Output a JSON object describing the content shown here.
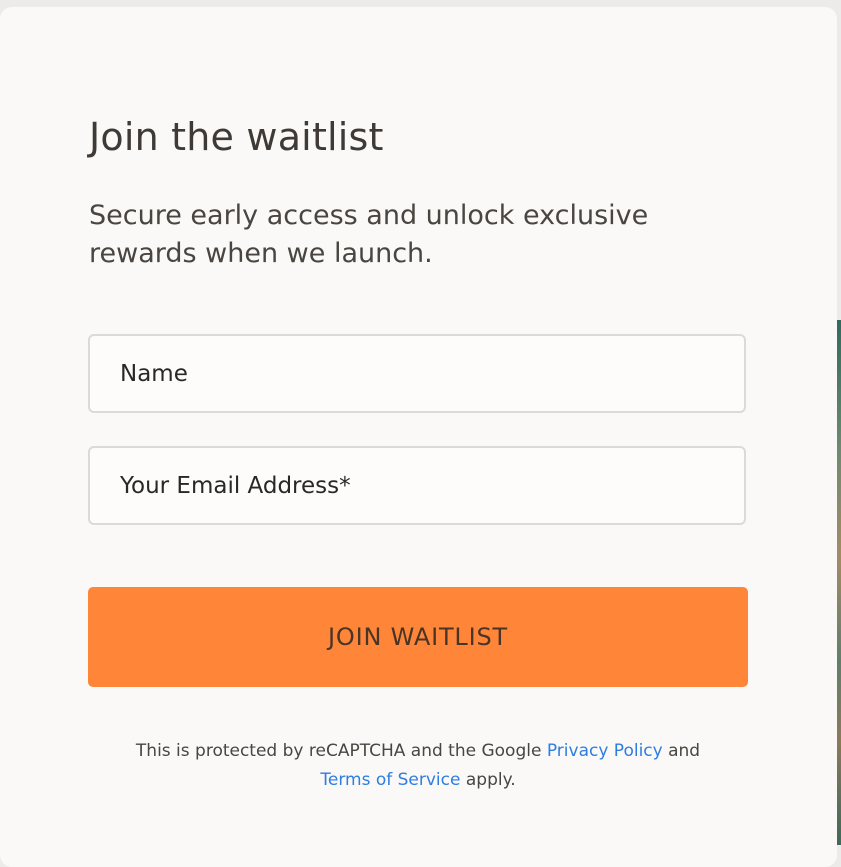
{
  "form": {
    "title": "Join the waitlist",
    "subtitle": "Secure early access and unlock exclusive rewards when we launch.",
    "name_placeholder": "Name",
    "email_placeholder": "Your Email Address*",
    "submit_label": "JOIN WAITLIST"
  },
  "legal": {
    "prefix": "This is protected by reCAPTCHA and the Google",
    "privacy_link": "Privacy Policy",
    "middle": "and",
    "terms_link": "Terms of Service",
    "suffix": "apply."
  },
  "colors": {
    "button": "#ff8638",
    "link": "#2e7de0",
    "card": "#faf9f7",
    "text": "#3f3a36"
  }
}
